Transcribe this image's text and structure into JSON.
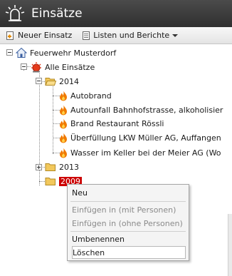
{
  "app": {
    "title": "Einsätze"
  },
  "toolbar": {
    "new_label": "Neuer Einsatz",
    "reports_label": "Listen und Berichte"
  },
  "tree": {
    "root": "Feuerwehr Musterdorf",
    "all": "Alle Einsätze",
    "year_2014": "2014",
    "items": [
      "Autobrand",
      "Autounfall Bahnhofstrasse, alkoholisier",
      "Brand Restaurant Rössli",
      "Überfüllung LKW Müller AG, Auffangen",
      "Wasser im Keller bei der Meier AG (Wo"
    ],
    "year_2013": "2013",
    "year_2009": "2009"
  },
  "context_menu": {
    "new": "Neu",
    "insert_with": "Einfügen in (mit Personen)",
    "insert_without": "Einfügen in (ohne Personen)",
    "rename": "Umbenennen",
    "delete": "Löschen"
  },
  "colors": {
    "selected": "#cc0000",
    "titlebar": "#3a3a3a",
    "flame": "#f07a00"
  }
}
